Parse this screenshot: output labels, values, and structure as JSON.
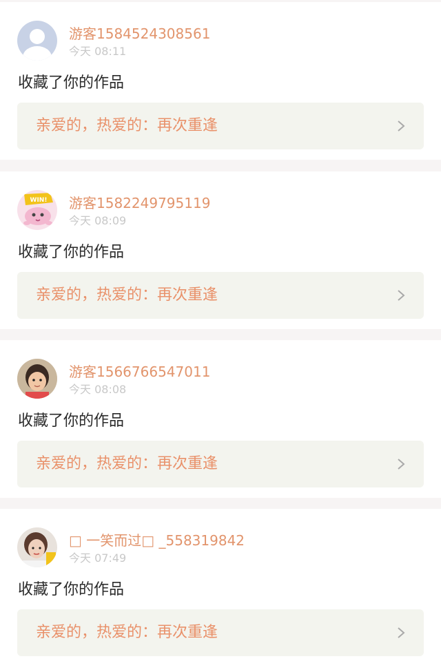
{
  "notifications": [
    {
      "username": "游客1584524308561",
      "time": "今天 08:11",
      "action": "收藏了你的作品",
      "work_title": "亲爱的，热爱的：再次重逢",
      "avatar": "default-person-avatar"
    },
    {
      "username": "游客1582249795119",
      "time": "今天 08:09",
      "action": "收藏了你的作品",
      "work_title": "亲爱的，热爱的：再次重逢",
      "avatar": "pink-octopus-win-avatar",
      "avatar_badge": "WIN!"
    },
    {
      "username": "游客1566766547011",
      "time": "今天 08:08",
      "action": "收藏了你的作品",
      "work_title": "亲爱的，热爱的：再次重逢",
      "avatar": "child-photo-avatar"
    },
    {
      "username": "□ 一笑而过□ _558319842",
      "time": "今天 07:49",
      "action": "收藏了你的作品",
      "work_title": "亲爱的，热爱的：再次重逢",
      "avatar": "woman-photo-avatar"
    }
  ],
  "colors": {
    "username": "#e2946c",
    "work_title": "#e9916a",
    "time": "#c8c8c8",
    "page_background": "#f7f4f4",
    "card_background": "#ffffff",
    "link_background": "#f3f4ee"
  }
}
